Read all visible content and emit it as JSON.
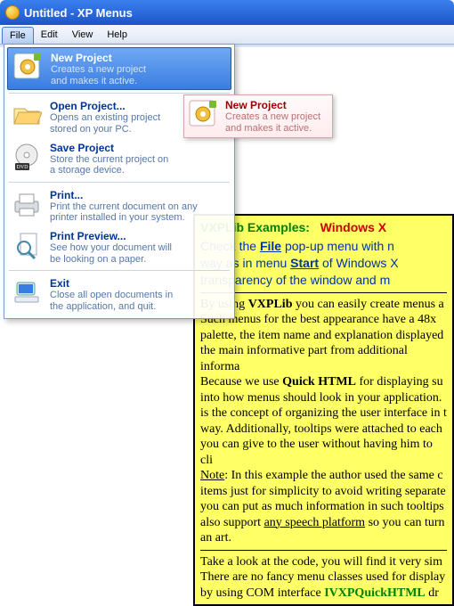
{
  "window": {
    "title": "Untitled - XP Menus"
  },
  "menubar": {
    "items": [
      "File",
      "Edit",
      "View",
      "Help"
    ],
    "active_index": 0
  },
  "dropdown": {
    "items": [
      {
        "id": "new-project",
        "title": "New Project",
        "desc": "Creates a new project\nand makes it active.",
        "icon": "project-new-icon"
      },
      {
        "id": "open-project",
        "title": "Open Project...",
        "desc": "Opens an existing project\nstored on your PC.",
        "icon": "folder-open-icon"
      },
      {
        "id": "save-project",
        "title": "Save Project",
        "desc": "Store the current project on\na storage device.",
        "icon": "dvd-disc-icon"
      },
      {
        "id": "print",
        "title": "Print...",
        "desc": "Print the current document on any\nprinter installed in your system.",
        "icon": "printer-icon"
      },
      {
        "id": "print-preview",
        "title": "Print Preview...",
        "desc": "See how your document will\nbe looking on a paper.",
        "icon": "magnifier-page-icon"
      },
      {
        "id": "exit",
        "title": "Exit",
        "desc": "Close all open documents in\nthe application, and quit.",
        "icon": "computer-icon"
      }
    ],
    "selected_index": 0,
    "separators_after": [
      0,
      2,
      4
    ]
  },
  "tooltip": {
    "title": "New Project",
    "desc": "Creates a new project\nand makes it active.",
    "icon": "project-new-icon"
  },
  "infobox": {
    "heading_title": "VXPLib Examples:",
    "heading_sub": "Windows X",
    "intro_parts": {
      "p1": "Check the ",
      "file": "File",
      "p2": " pop-up menu with n",
      "p3": "way as in menu ",
      "start": "Start",
      "p4": " of Windows X",
      "p5": "transparency of the window and m"
    },
    "body_parts": {
      "a1": "By using ",
      "vxplib": "VXPLib",
      "a2": " you can easily create menus a",
      "a3": "Such menus for the best appearance have a 48x",
      "a4": "palette, the item name and explanation displayed",
      "a5": "the main informative part from additional informa",
      "a6": "Because we use ",
      "qh": "Quick HTML",
      "a7": " for displaying su",
      "a8": "into how menus should look in your application. ",
      "a9": "is the concept of organizing the user interface in t",
      "a10": "way. Additionally, tooltips were attached to each",
      "a11": "you can give to the user without having him to cli",
      "note": "Note",
      "a12": ": In this example the author used the same c",
      "a13": "items just for simplicity to avoid writing separate ",
      "a14": "you can put as much information in such tooltips ",
      "a15": "also support ",
      "speech": "any speech platform",
      "a16": " so you can turn",
      "a17": "an art.",
      "b1": "Take a look at the code, you will find it very sim",
      "b2": "There are no fancy menu classes used for display",
      "b3": "by using COM interface ",
      "iface": "IVXPQuickHTML",
      "b4": " dr"
    }
  }
}
